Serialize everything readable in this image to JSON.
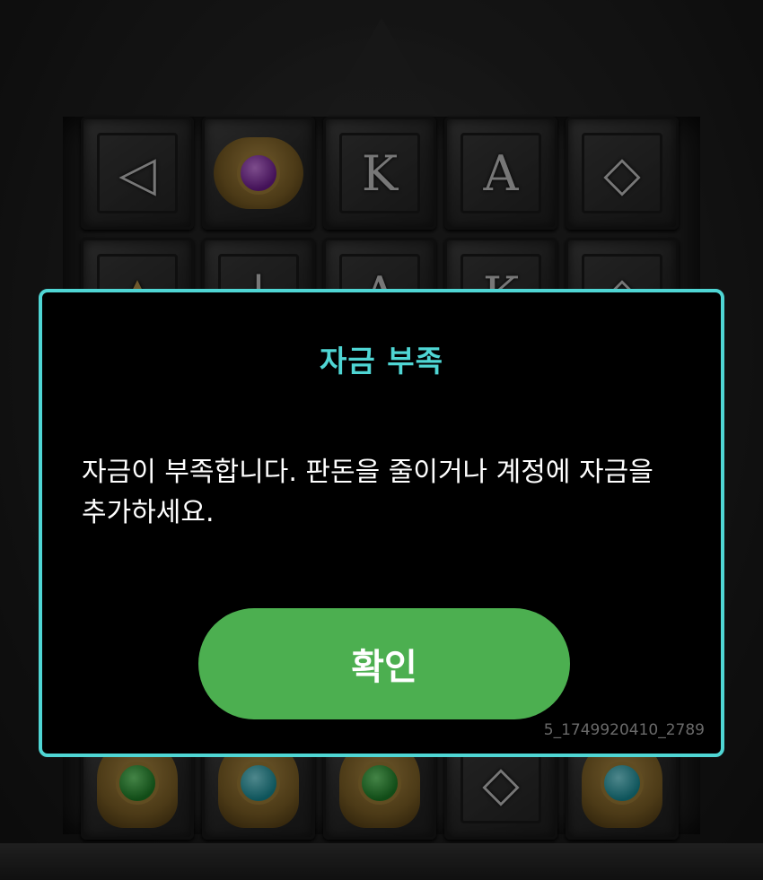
{
  "background": {
    "reels": {
      "row1": [
        "◁",
        "eye-of-horus",
        "K",
        "A",
        "◇"
      ],
      "row2": [
        "▲",
        "|",
        "A",
        "K",
        "◇"
      ],
      "row_bottom": [
        "scarab-green",
        "scarab-cyan",
        "scarab-green",
        "◇",
        "scarab-cyan"
      ]
    }
  },
  "dialog": {
    "title": "자금 부족",
    "message": "자금이 부족합니다. 판돈을 줄이거나 계정에 자금을 추가하세요.",
    "confirm_label": "확인",
    "session_id": "5_1749920410_2789"
  },
  "colors": {
    "accent": "#4fd6d4",
    "confirm_button": "#4caf50",
    "dialog_bg": "#000000"
  }
}
